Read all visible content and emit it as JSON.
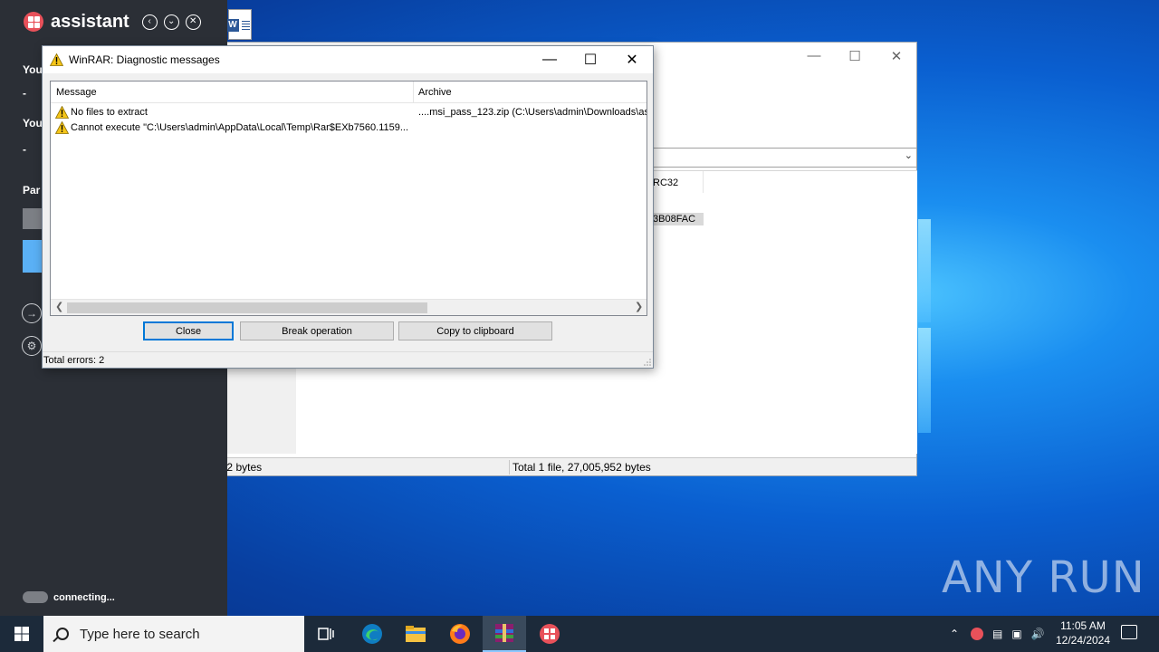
{
  "assistant": {
    "title": "assistant",
    "fragments": [
      "You",
      "-",
      "You",
      "-",
      "Par"
    ],
    "status": "connecting..."
  },
  "bg_window": {
    "list_col_fragment": "RC32",
    "list_cell_fragment": "3B08FAC",
    "status_selected": "Selected 1 file, 27,005,952 bytes",
    "status_total": "Total 1 file, 27,005,952 bytes"
  },
  "dialog": {
    "title": "WinRAR: Diagnostic messages",
    "columns": [
      "Message",
      "Archive"
    ],
    "rows": [
      {
        "message": "No files to extract",
        "archive": "....msi_pass_123.zip (C:\\Users\\admin\\Downloads\\as"
      },
      {
        "message": "Cannot execute \"C:\\Users\\admin\\AppData\\Local\\Temp\\Rar$EXb7560.1159...",
        "archive": ""
      }
    ],
    "buttons": {
      "close": "Close",
      "break": "Break operation",
      "copy": "Copy to clipboard"
    },
    "status": "Total errors: 2"
  },
  "taskbar": {
    "search_placeholder": "Type here to search",
    "time": "11:05 AM",
    "date": "12/24/2024"
  },
  "watermark": "ANY RUN",
  "colors": {
    "assistant_bg": "#2b2f36",
    "accent": "#0078d7",
    "taskbar_bg": "#1c2a3a",
    "warning": "#f5c518"
  }
}
